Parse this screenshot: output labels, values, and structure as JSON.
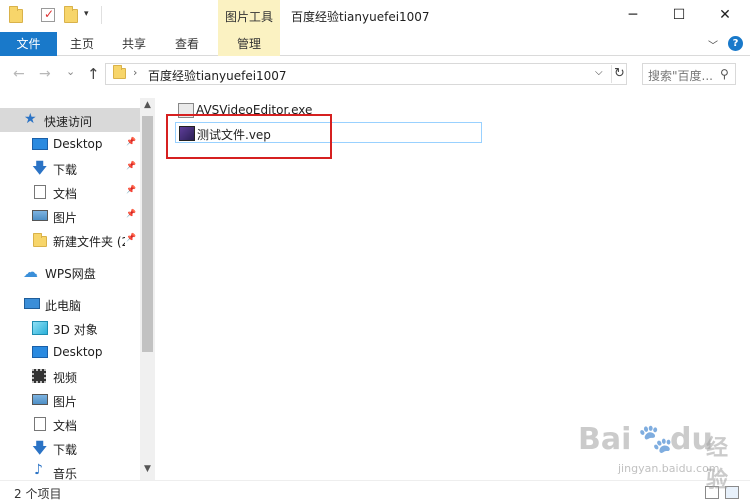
{
  "window": {
    "title": "百度经验tianyuefei1007",
    "context_tab_title": "图片工具",
    "minimize": "─",
    "maximize": "☐",
    "close": "✕"
  },
  "quick_access_toolbar": {
    "dropdown_glyph": "▾"
  },
  "ribbon": {
    "tabs": [
      "文件",
      "主页",
      "共享",
      "查看",
      "管理"
    ],
    "collapse_glyph": "﹀",
    "help_glyph": "?"
  },
  "address_bar": {
    "path": "百度经验tianyuefei1007",
    "separator": "›",
    "dropdown_glyph": "⌵",
    "refresh_glyph": "↻",
    "search_placeholder": "搜索\"百度...",
    "search_glyph": "⚲"
  },
  "nav": {
    "back": "←",
    "forward": "→",
    "recent": "⌄",
    "up": "↑"
  },
  "sidebar": {
    "quick_access": "快速访问",
    "qa_items": [
      {
        "label": "Desktop",
        "icon": "desktop-icon",
        "pinned": true
      },
      {
        "label": "下载",
        "icon": "download-icon",
        "pinned": true
      },
      {
        "label": "文档",
        "icon": "document-icon",
        "pinned": true
      },
      {
        "label": "图片",
        "icon": "picture-icon",
        "pinned": true
      },
      {
        "label": "新建文件夹 (2",
        "icon": "folder-icon",
        "pinned": true
      }
    ],
    "pin_glyph": "📌",
    "wps": "WPS网盘",
    "this_pc": "此电脑",
    "pc_items": [
      {
        "label": "3D 对象",
        "icon": "3d-objects-icon"
      },
      {
        "label": "Desktop",
        "icon": "desktop-icon"
      },
      {
        "label": "视频",
        "icon": "video-icon"
      },
      {
        "label": "图片",
        "icon": "picture-icon"
      },
      {
        "label": "文档",
        "icon": "document-icon"
      },
      {
        "label": "下载",
        "icon": "download-icon"
      },
      {
        "label": "音乐",
        "icon": "music-icon"
      }
    ],
    "scroll_up": "▲",
    "scroll_down": "▼"
  },
  "files": [
    {
      "name": "AVSVideoEditor.exe",
      "icon": "exe-icon",
      "selected": false
    },
    {
      "name": "测试文件.vep",
      "icon": "vep-file-icon",
      "selected": true
    }
  ],
  "status": {
    "item_count": "2 个项目"
  },
  "watermark": {
    "brand": "Bai",
    "brand2": "du",
    "text": "经验",
    "url": "jingyan.baidu.com"
  },
  "colors": {
    "accent": "#1979ca",
    "context_tab": "#fbf2c2",
    "selection": "#d9d9d9",
    "highlight_box": "#d62020"
  }
}
